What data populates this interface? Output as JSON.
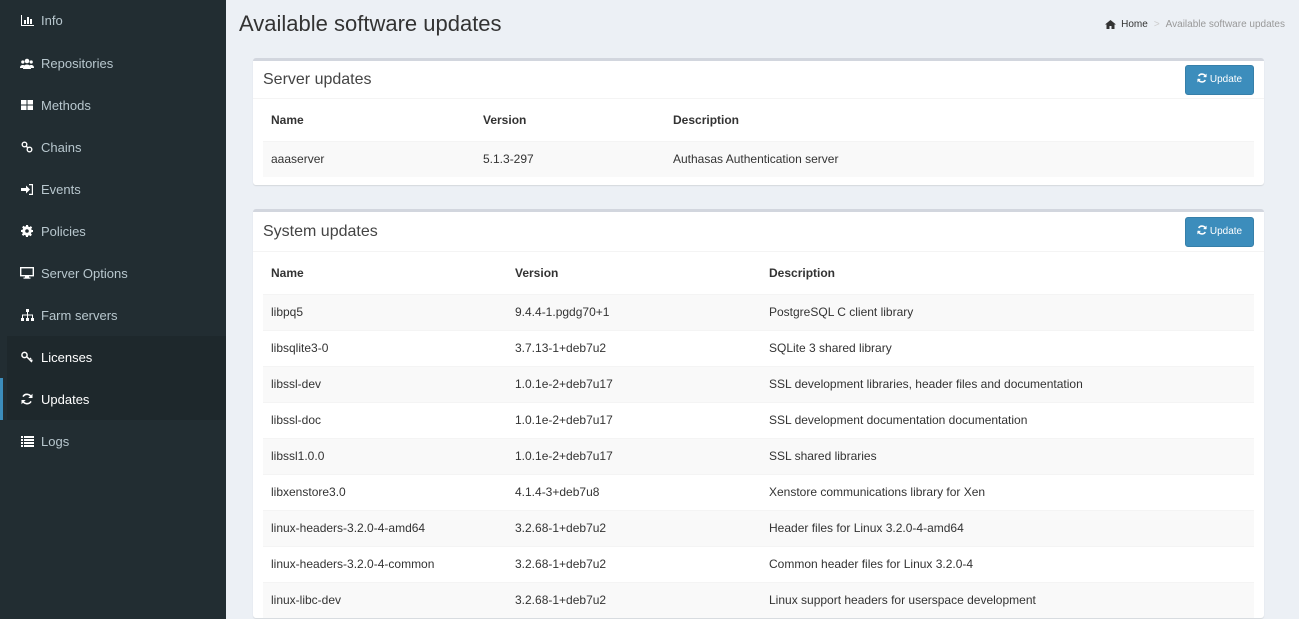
{
  "sidebar": {
    "items": [
      {
        "label": "Info",
        "icon": "bar-chart-icon"
      },
      {
        "label": "Repositories",
        "icon": "users-icon"
      },
      {
        "label": "Methods",
        "icon": "th-large-icon"
      },
      {
        "label": "Chains",
        "icon": "chain-icon"
      },
      {
        "label": "Events",
        "icon": "sign-in-icon"
      },
      {
        "label": "Policies",
        "icon": "cog-icon"
      },
      {
        "label": "Server Options",
        "icon": "desktop-icon"
      },
      {
        "label": "Farm servers",
        "icon": "sitemap-icon"
      },
      {
        "label": "Licenses",
        "icon": "key-icon"
      },
      {
        "label": "Updates",
        "icon": "refresh-icon"
      },
      {
        "label": "Logs",
        "icon": "list-icon"
      }
    ]
  },
  "header": {
    "title": "Available software updates",
    "breadcrumb": {
      "home": "Home",
      "current": "Available software updates"
    }
  },
  "server_updates": {
    "title": "Server updates",
    "button": "Update",
    "columns": [
      "Name",
      "Version",
      "Description"
    ],
    "rows": [
      [
        "aaaserver",
        "5.1.3-297",
        "Authasas Authentication server"
      ]
    ]
  },
  "system_updates": {
    "title": "System updates",
    "button": "Update",
    "columns": [
      "Name",
      "Version",
      "Description"
    ],
    "rows": [
      [
        "libpq5",
        "9.4.4-1.pgdg70+1",
        "PostgreSQL C client library"
      ],
      [
        "libsqlite3-0",
        "3.7.13-1+deb7u2",
        "SQLite 3 shared library"
      ],
      [
        "libssl-dev",
        "1.0.1e-2+deb7u17",
        "SSL development libraries, header files and documentation"
      ],
      [
        "libssl-doc",
        "1.0.1e-2+deb7u17",
        "SSL development documentation documentation"
      ],
      [
        "libssl1.0.0",
        "1.0.1e-2+deb7u17",
        "SSL shared libraries"
      ],
      [
        "libxenstore3.0",
        "4.1.4-3+deb7u8",
        "Xenstore communications library for Xen"
      ],
      [
        "linux-headers-3.2.0-4-amd64",
        "3.2.68-1+deb7u2",
        "Header files for Linux 3.2.0-4-amd64"
      ],
      [
        "linux-headers-3.2.0-4-common",
        "3.2.68-1+deb7u2",
        "Common header files for Linux 3.2.0-4"
      ],
      [
        "linux-libc-dev",
        "3.2.68-1+deb7u2",
        "Linux support headers for userspace development"
      ]
    ]
  },
  "colors": {
    "sidebar_bg": "#222d32",
    "accent": "#3c8dbc",
    "content_bg": "#ecf0f5"
  }
}
